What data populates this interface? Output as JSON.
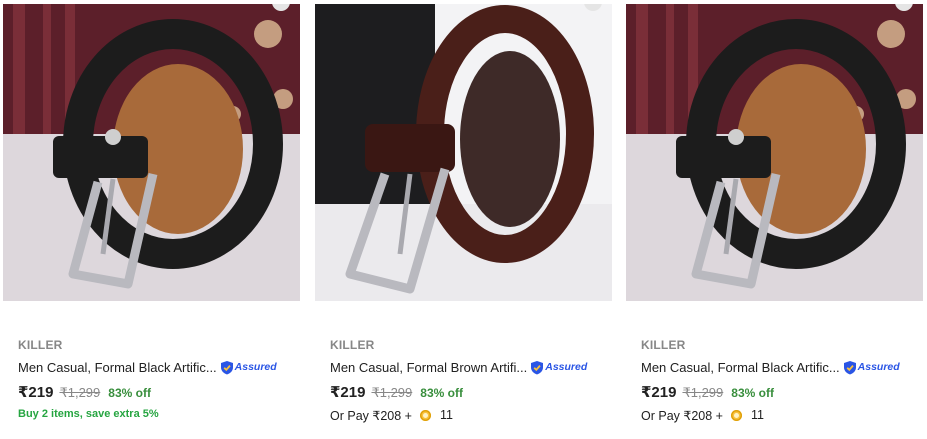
{
  "products": [
    {
      "brand": "KILLER",
      "title": "Men Casual, Formal Black Artific...",
      "assured_label": "Assured",
      "price": "₹219",
      "mrp": "₹1,299",
      "discount": "83% off",
      "offer": "Buy 2 items, save extra 5%",
      "pay_text": "",
      "coins": "",
      "belt_color": "#1c1c1c",
      "icon": "belt-image"
    },
    {
      "brand": "KILLER",
      "title": "Men Casual, Formal Brown Artifi...",
      "assured_label": "Assured",
      "price": "₹219",
      "mrp": "₹1,299",
      "discount": "83% off",
      "offer": "",
      "pay_text": "Or Pay ₹208 +",
      "coins": "11",
      "belt_color": "#4a1f19",
      "icon": "belt-image"
    },
    {
      "brand": "KILLER",
      "title": "Men Casual, Formal Black Artific...",
      "assured_label": "Assured",
      "price": "₹219",
      "mrp": "₹1,299",
      "discount": "83% off",
      "offer": "",
      "pay_text": "Or Pay ₹208 +",
      "coins": "11",
      "belt_color": "#1c1c1c",
      "icon": "belt-image"
    }
  ],
  "colors": {
    "brand_gray": "#878787",
    "discount_green": "#388e3c",
    "offer_green": "#26a541",
    "assured_blue": "#2a55e5",
    "coin_yellow": "#f9c23c"
  }
}
